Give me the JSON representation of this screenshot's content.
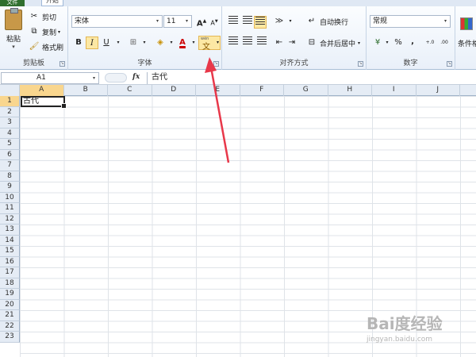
{
  "tabs": [
    "文件",
    "开始"
  ],
  "ribbon": {
    "clipboard": {
      "paste": "粘贴",
      "cut": "剪切",
      "copy": "复制",
      "format_painter": "格式刷",
      "group_label": "剪贴板"
    },
    "font": {
      "font_name": "宋体",
      "font_size": "11",
      "bold": "B",
      "italic": "I",
      "underline": "U",
      "group_label": "字体",
      "phonetic_top": "wén",
      "phonetic_char": "文"
    },
    "alignment": {
      "wrap_text": "自动换行",
      "merge_center": "合并后居中",
      "group_label": "对齐方式"
    },
    "number": {
      "format": "常规",
      "percent": "%",
      "comma": ",",
      "group_label": "数字"
    },
    "styles": {
      "conditional": "条件格"
    }
  },
  "formula_bar": {
    "name_box": "A1",
    "fx": "fx",
    "content": "古代"
  },
  "sheet": {
    "columns": [
      "A",
      "B",
      "C",
      "D",
      "E",
      "F",
      "G",
      "H",
      "I",
      "J"
    ],
    "rows": [
      "1",
      "2",
      "3",
      "4",
      "5",
      "6",
      "7",
      "8",
      "9",
      "10",
      "11",
      "12",
      "13",
      "14",
      "15",
      "16",
      "17",
      "18",
      "19",
      "20",
      "21",
      "22",
      "23"
    ],
    "active_cell": "A1",
    "cell_a1": "古代"
  },
  "colors": {
    "file_tab": "#2f6f2e",
    "selection_header": "#f9d68e",
    "annotation_arrow": "#e8384a"
  },
  "watermark": {
    "brand": "Bai度经验",
    "url": "jingyan.baidu.com"
  }
}
